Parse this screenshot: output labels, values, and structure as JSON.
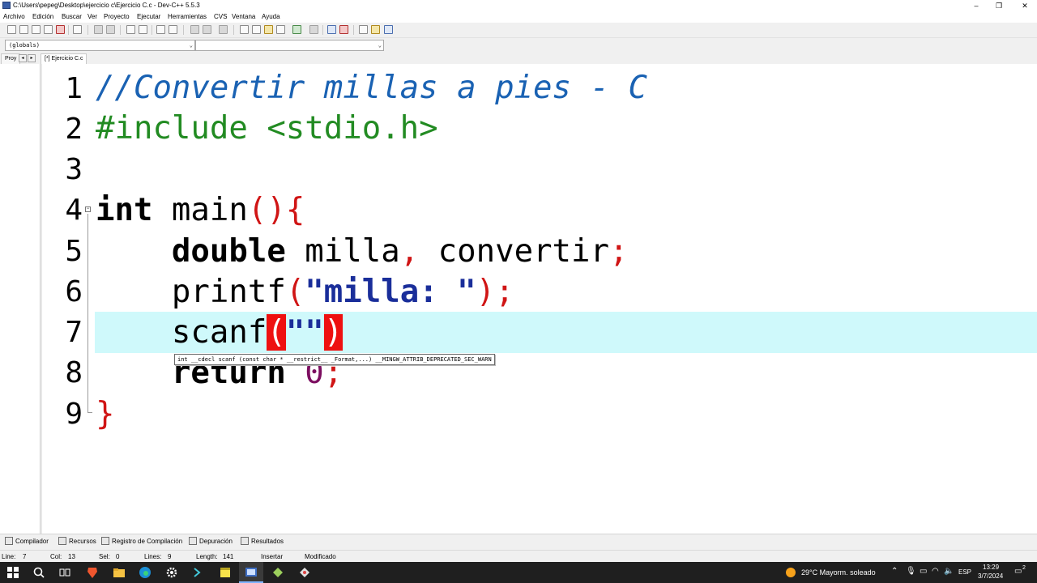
{
  "window": {
    "title": "C:\\Users\\pepeg\\Desktop\\ejercicio  c\\Ejercicio C.c - Dev-C++ 5.5.3"
  },
  "menu": [
    "Archivo",
    "Edición",
    "Buscar",
    "Ver",
    "Proyecto",
    "Ejecutar",
    "Herramientas",
    "CVS",
    "Ventana",
    "Ayuda"
  ],
  "combos": {
    "scope": "(globals)",
    "member": ""
  },
  "left_tab": "Proy",
  "editor_tab": "[*] Ejercicio C.c",
  "code": {
    "line_numbers": [
      "1",
      "2",
      "3",
      "4",
      "5",
      "6",
      "7",
      "8",
      "9"
    ],
    "line1": "//Convertir millas a pies - C",
    "line2": "#include <stdio.h>",
    "line4_kw": "int",
    "line4_name": " main",
    "line4_punct": "(){",
    "line5_indent": "    ",
    "line5_kw": "double",
    "line5_text": " milla",
    "line5_comma": ",",
    "line5_text2": " convertir",
    "line5_semi": ";",
    "line6_fn": "printf",
    "line6_open": "(",
    "line6_str": "\"milla: \"",
    "line6_close": ");",
    "line7_fn": "scanf",
    "line7_open": "(",
    "line7_str": "\"\"",
    "line7_close": ")",
    "line8_kw": "return",
    "line8_num": "0",
    "line8_semi": ";",
    "line9": "}"
  },
  "tooltip": "int __cdecl scanf (const char * __restrict__ _Format,...) __MINGW_ATTRIB_DEPRECATED_SEC_WARN",
  "bottom_tabs": [
    "Compilador",
    "Recursos",
    "Registro de Compilación",
    "Depuración",
    "Resultados"
  ],
  "status": {
    "line_label": "Line:",
    "line_value": "7",
    "col_label": "Col:",
    "col_value": "13",
    "sel_label": "Sel:",
    "sel_value": "0",
    "lines_label": "Lines:",
    "lines_value": "9",
    "length_label": "Length:",
    "length_value": "141",
    "mode": "Insertar",
    "state": "Modificado"
  },
  "taskbar": {
    "weather": "29°C  Mayorm. soleado",
    "lang": "ESP",
    "time": "13:29",
    "date": "3/7/2024",
    "notifications": "2"
  },
  "colors": {
    "comment": "#1a62b3",
    "preprocessor": "#228b22",
    "punctuation": "#d01515",
    "string": "#1a2e9a",
    "number": "#7c0e60",
    "current_line": "#cff9fb",
    "brace_match": "#ee1010"
  }
}
